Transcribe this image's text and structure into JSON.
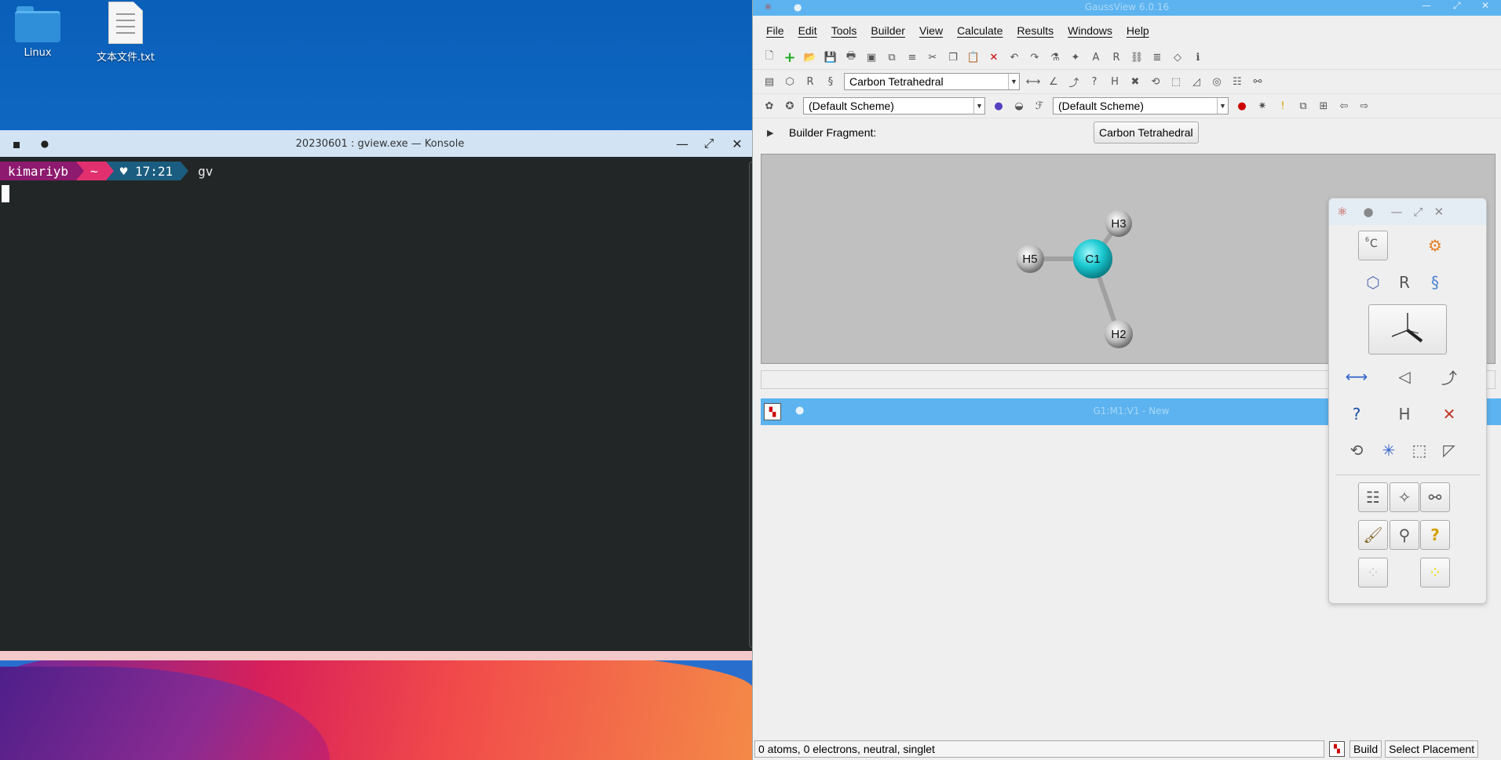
{
  "desktop": {
    "icons": [
      {
        "label": "Linux",
        "icon": "folder-icon"
      },
      {
        "label": "文本文件.txt",
        "icon": "text-file-icon"
      }
    ]
  },
  "konsole": {
    "title": "20230601 : gview.exe — Konsole",
    "prompt": {
      "user": "kimariyb",
      "dir": "~",
      "time": "♥ 17:21",
      "command": "gv"
    }
  },
  "gaussview": {
    "title": "GaussView 6.0.16",
    "menu": [
      "File",
      "Edit",
      "Tools",
      "Builder",
      "View",
      "Calculate",
      "Results",
      "Windows",
      "Help"
    ],
    "fragment_select": "Carbon Tetrahedral",
    "scheme_left": "(Default Scheme)",
    "scheme_right": "(Default Scheme)",
    "builder_fragment_label": "Builder Fragment:",
    "builder_fragment_value": "Carbon Tetrahedral",
    "molecule": {
      "atoms": [
        "C1",
        "H2",
        "H3",
        "H5"
      ],
      "colors": {
        "carbon": "#19c8d0",
        "hydrogen": "#d8d8d8"
      }
    },
    "view_title": "G1:M1:V1 - New",
    "status": {
      "info": "0 atoms, 0 electrons, neutral, singlet",
      "mode": "Build",
      "placement": "Select Placement"
    }
  },
  "palette": {
    "element_label": "C",
    "element_number": "6"
  }
}
